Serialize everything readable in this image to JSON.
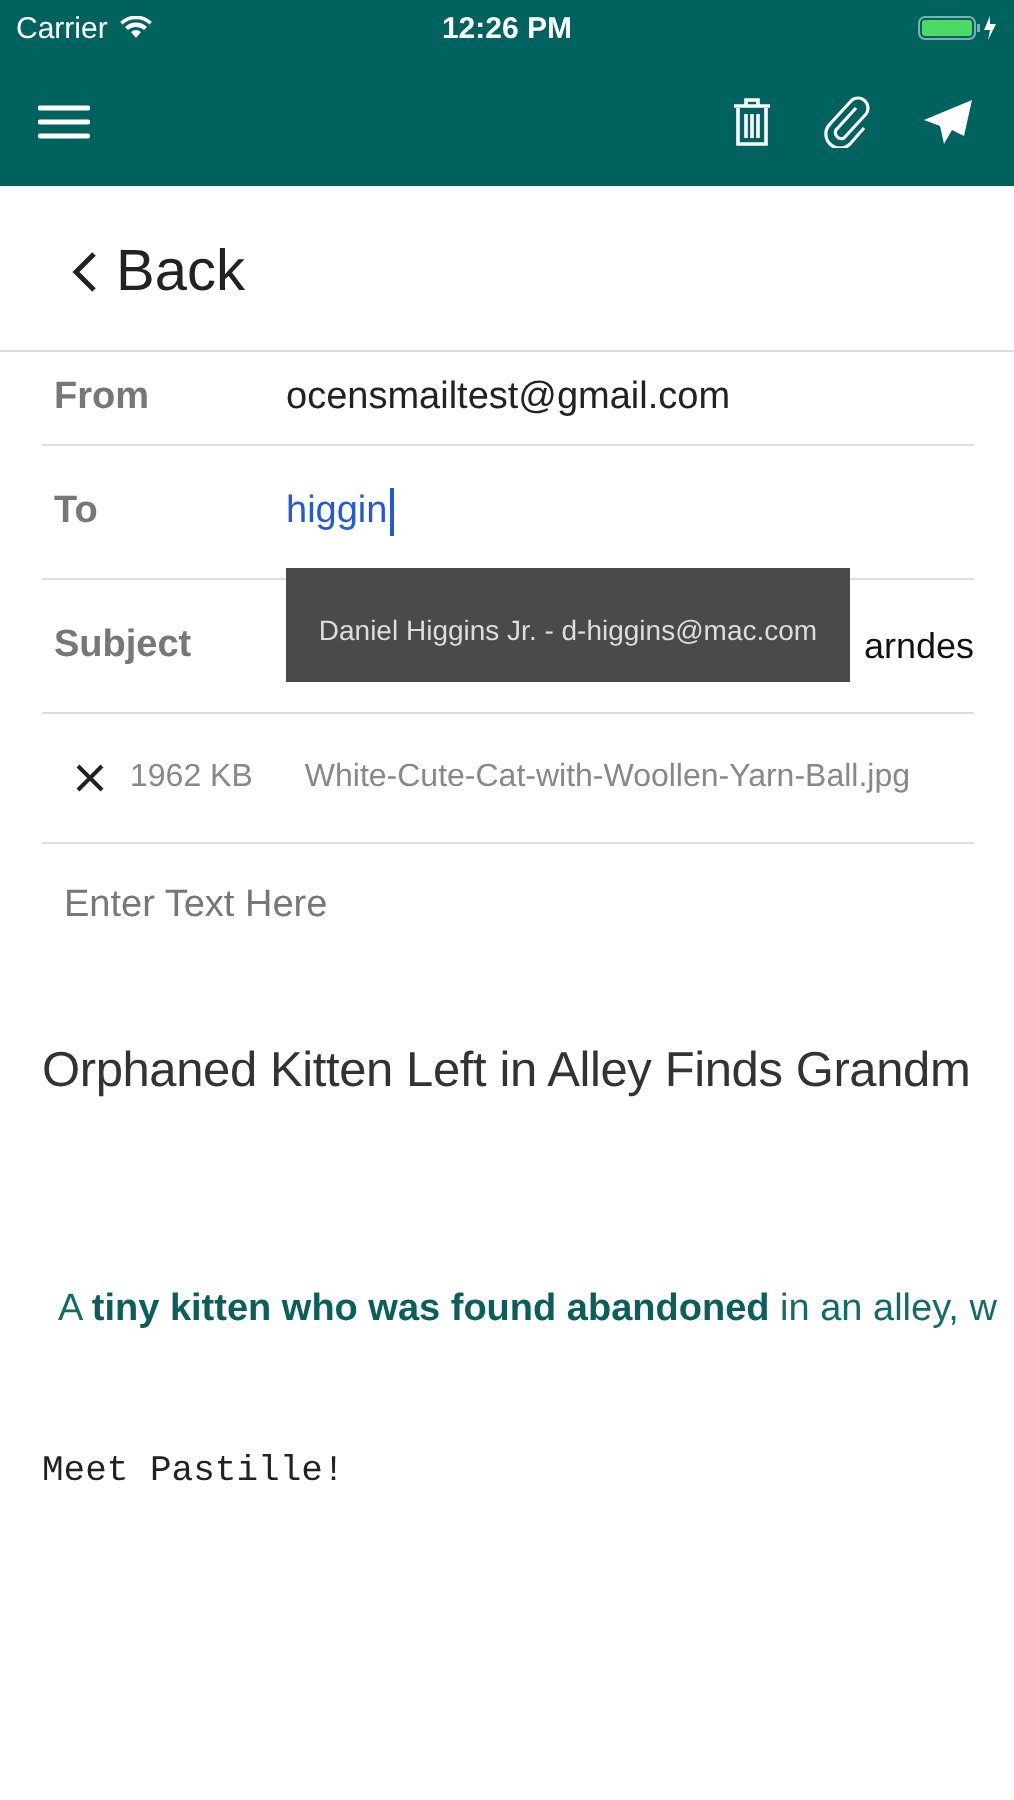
{
  "status_bar": {
    "carrier": "Carrier",
    "time": "12:26 PM"
  },
  "back": {
    "label": "Back"
  },
  "fields": [
    {
      "kind": "text",
      "label": "From",
      "value": "ocensmailtest@gmail.com"
    },
    {
      "kind": "input",
      "label": "To",
      "value": "higgin"
    },
    {
      "kind": "text",
      "label": "Subject",
      "value": "arndes"
    }
  ],
  "suggestion": "Daniel Higgins Jr. - d-higgins@mac.com",
  "attachment": {
    "size": "1962 KB",
    "name": "White-Cute-Cat-with-Woollen-Yarn-Ball.jpg"
  },
  "body": {
    "placeholder": "Enter Text Here",
    "heading": "Orphaned Kitten Left in Alley Finds Grandm",
    "paragraph": "A **tiny kitten who was found abandoned** in an alley, w",
    "mono": "Meet Pastille!"
  }
}
